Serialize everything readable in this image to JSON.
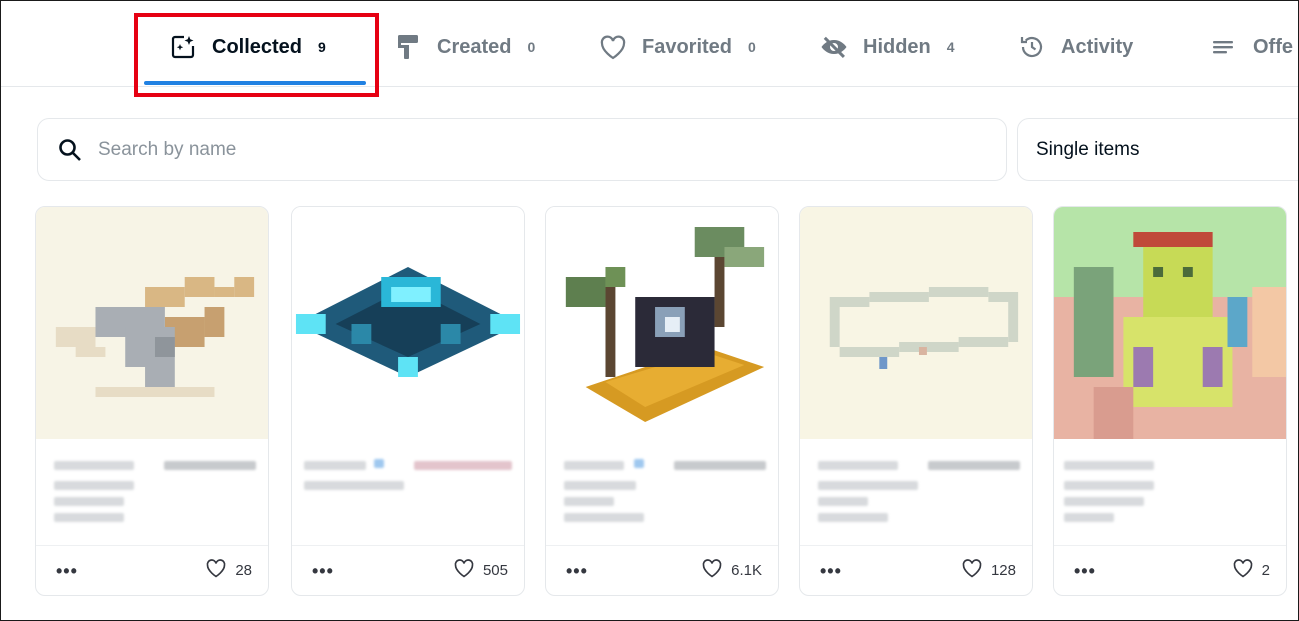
{
  "tabs": [
    {
      "label": "Collected",
      "count": "9",
      "icon": "collected-sparkle-icon",
      "active": true
    },
    {
      "label": "Created",
      "count": "0",
      "icon": "paint-roller-icon",
      "active": false
    },
    {
      "label": "Favorited",
      "count": "0",
      "icon": "heart-icon",
      "active": false
    },
    {
      "label": "Hidden",
      "count": "4",
      "icon": "eye-off-icon",
      "active": false
    },
    {
      "label": "Activity",
      "count": "",
      "icon": "history-icon",
      "active": false
    },
    {
      "label": "Offe",
      "count": "",
      "icon": "list-icon",
      "active": false
    }
  ],
  "search": {
    "placeholder": "Search by name",
    "icon": "search-icon"
  },
  "filter": {
    "selected": "Single items"
  },
  "cards": [
    {
      "favorites": "28"
    },
    {
      "favorites": "505"
    },
    {
      "favorites": "6.1K"
    },
    {
      "favorites": "128"
    },
    {
      "favorites": "2"
    }
  ],
  "colors": {
    "accent": "#2081e2",
    "highlight": "#e60012",
    "text": "#04111d",
    "muted": "#707a83"
  }
}
